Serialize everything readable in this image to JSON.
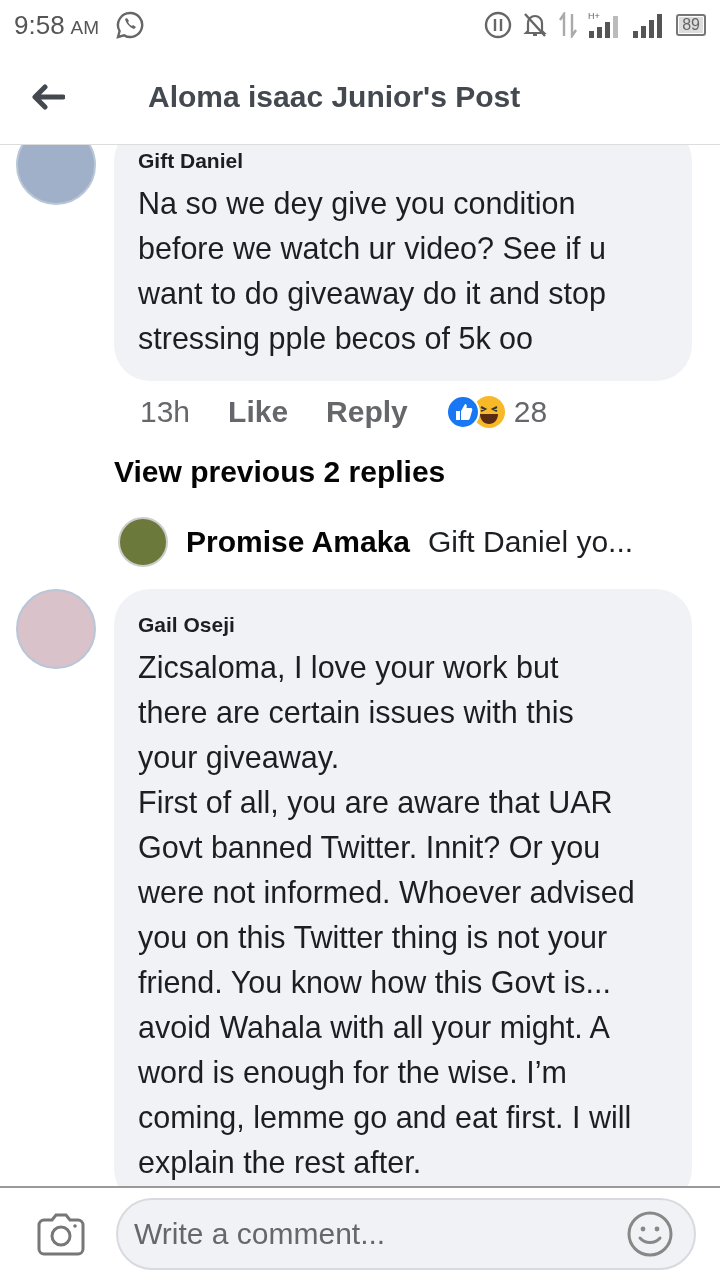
{
  "status_bar": {
    "time": "9:58",
    "ampm": "AM",
    "battery": "89",
    "network": "H+"
  },
  "header": {
    "title": "Aloma isaac Junior's Post"
  },
  "comments": [
    {
      "author": "Gift Daniel",
      "paragraphs": [
        "Na so we dey give you condition before we watch ur video? See if u want to do giveaway do it and stop stressing pple becos of 5k oo"
      ],
      "time": "13h",
      "like": "Like",
      "reply": "Reply",
      "reactions": [
        {
          "kind": "like"
        },
        {
          "kind": "haha"
        }
      ],
      "reaction_count": "28",
      "view_replies": "View previous 2 replies",
      "reply_preview": {
        "author": "Promise Amaka",
        "text": "Gift Daniel yo..."
      }
    },
    {
      "author": "Gail Oseji",
      "paragraphs": [
        "Zicsaloma, I love your work but there are certain issues with this your giveaway.",
        "First of all, you are aware that UAR Govt banned Twitter. Innit? Or you were not informed. Whoever advised you on this Twitter thing is not your friend. You know how this Govt is... avoid Wahala with all your might. A word is enough for the wise. I’m coming, lemme go and eat first. I will explain the rest after."
      ]
    }
  ],
  "composer": {
    "placeholder": "Write a comment..."
  }
}
